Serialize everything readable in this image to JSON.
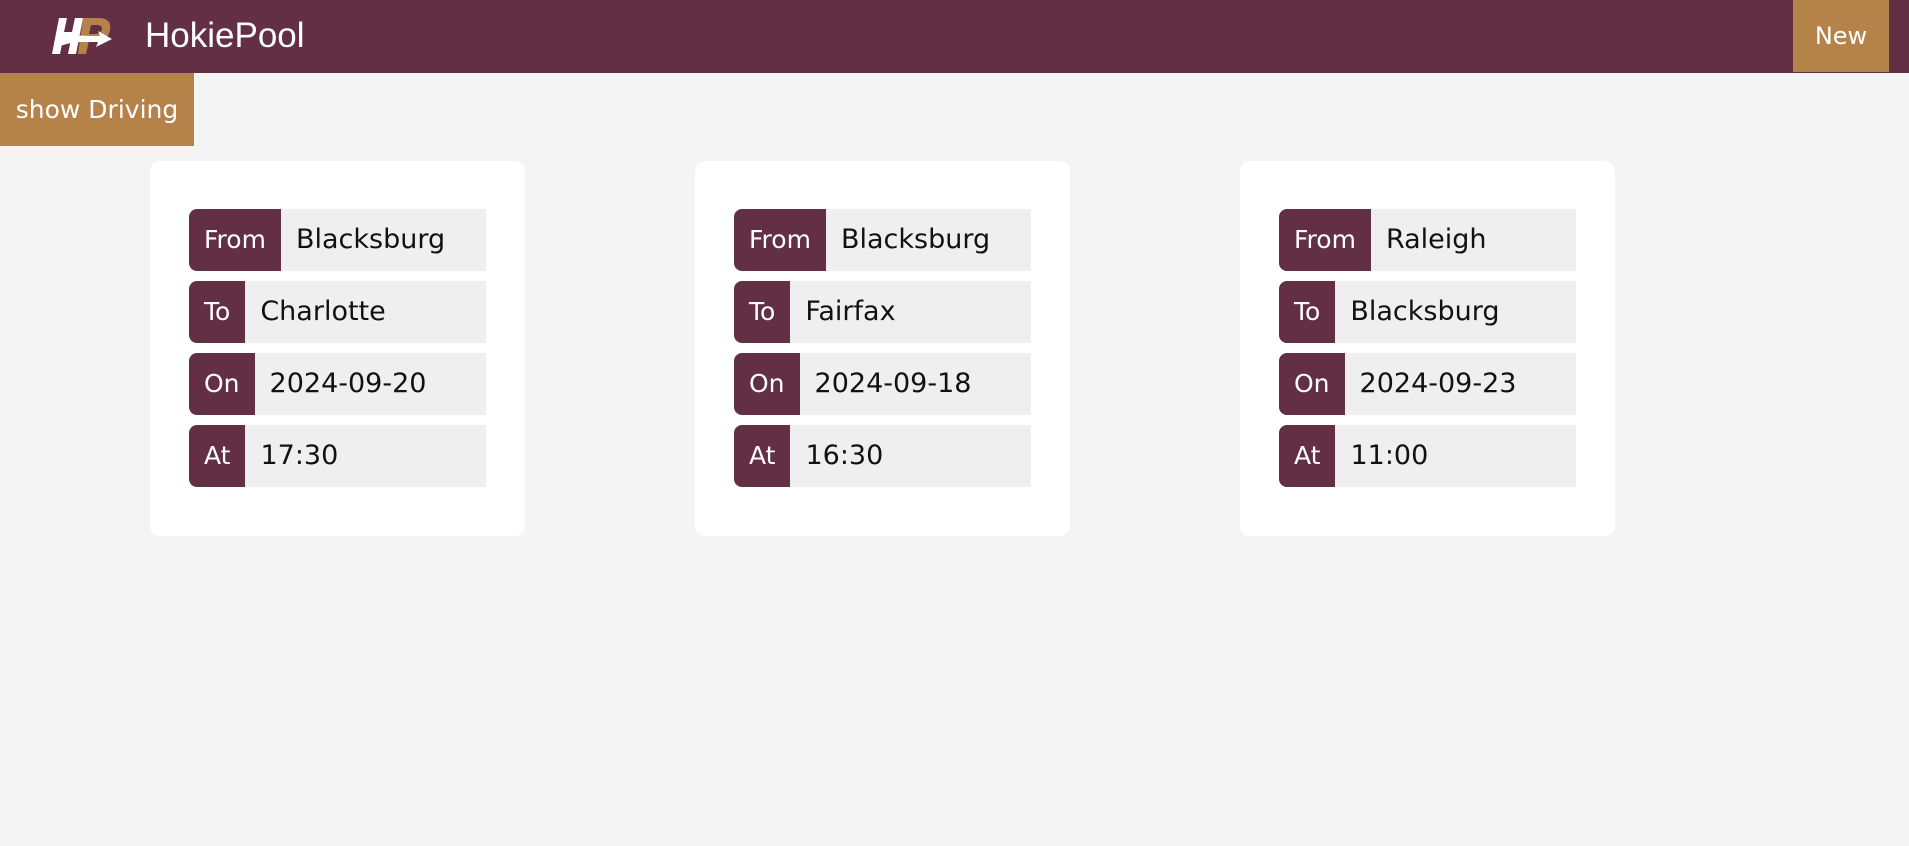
{
  "app": {
    "title": "HokiePool",
    "logo_icon": "hokiepool-logo-icon"
  },
  "toolbar": {
    "new_label": "New",
    "show_driving_label": "show Driving"
  },
  "colors": {
    "primary": "#632f45",
    "accent": "#b5834a",
    "background": "#f4f4f4"
  },
  "rides": [
    {
      "from_label": "From",
      "from": "Blacksburg",
      "to_label": "To",
      "to": "Charlotte",
      "on_label": "On",
      "on": "2024-09-20",
      "at_label": "At",
      "at": "17:30"
    },
    {
      "from_label": "From",
      "from": "Blacksburg",
      "to_label": "To",
      "to": "Fairfax",
      "on_label": "On",
      "on": "2024-09-18",
      "at_label": "At",
      "at": "16:30"
    },
    {
      "from_label": "From",
      "from": "Raleigh",
      "to_label": "To",
      "to": "Blacksburg",
      "on_label": "On",
      "on": "2024-09-23",
      "at_label": "At",
      "at": "11:00"
    }
  ]
}
